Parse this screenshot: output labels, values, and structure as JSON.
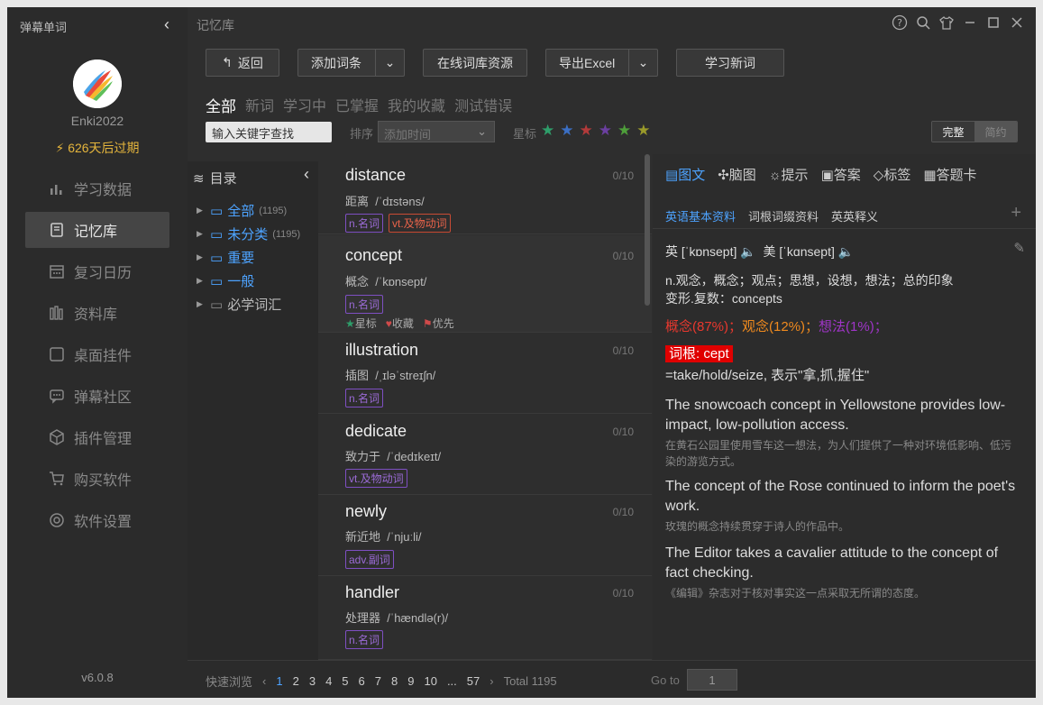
{
  "app": {
    "title": "弹幕单词",
    "username": "Enki2022",
    "expiry": "626天后过期",
    "version": "v6.0.8"
  },
  "nav": [
    {
      "label": "学习数据",
      "icon": "bar-chart-icon"
    },
    {
      "label": "记忆库",
      "icon": "notebook-icon"
    },
    {
      "label": "复习日历",
      "icon": "calendar-icon"
    },
    {
      "label": "资料库",
      "icon": "books-icon"
    },
    {
      "label": "桌面挂件",
      "icon": "widget-icon"
    },
    {
      "label": "弹幕社区",
      "icon": "chat-icon"
    },
    {
      "label": "插件管理",
      "icon": "plugin-icon"
    },
    {
      "label": "购买软件",
      "icon": "cart-icon"
    },
    {
      "label": "软件设置",
      "icon": "settings-icon"
    }
  ],
  "window": {
    "title": "记忆库"
  },
  "toolbar": {
    "back": "返回",
    "add": "添加词条",
    "online": "在线词库资源",
    "export": "导出Excel",
    "learn": "学习新词"
  },
  "filters": {
    "tabs": [
      "全部",
      "新词",
      "学习中",
      "已掌握",
      "我的收藏",
      "测试错误"
    ],
    "search_placeholder": "输入关键字查找",
    "sort_label": "排序",
    "sort_value": "添加时间",
    "star_label": "星标",
    "star_colors": [
      "#2e9e6a",
      "#3b6fc4",
      "#b23a3a",
      "#6b3fa0",
      "#4e9e3a",
      "#9a9a2a"
    ],
    "mode_full": "完整",
    "mode_brief": "简约"
  },
  "tree": {
    "title": "目录",
    "items": [
      {
        "label": "全部",
        "count": "(1195)",
        "color": "#4da3ff"
      },
      {
        "label": "未分类",
        "count": "(1195)",
        "color": "#4da3ff"
      },
      {
        "label": "重要",
        "count": "",
        "color": "#4da3ff"
      },
      {
        "label": "一般",
        "count": "",
        "color": "#4da3ff"
      },
      {
        "label": "必学词汇",
        "count": "",
        "color": "#bbb"
      }
    ]
  },
  "words": [
    {
      "word": "distance",
      "score": "0/10",
      "meaning": "距离",
      "phon": "/ˈdɪstəns/",
      "pos": [
        "n.名词",
        "vt.及物动词"
      ]
    },
    {
      "word": "concept",
      "score": "0/10",
      "meaning": "概念",
      "phon": "/ˈkɒnsept/",
      "pos": [
        "n.名词"
      ],
      "meta": [
        "星标",
        "收藏",
        "优先"
      ]
    },
    {
      "word": "illustration",
      "score": "0/10",
      "meaning": "插图",
      "phon": "/ˌɪləˈstreɪʃn/",
      "pos": [
        "n.名词"
      ]
    },
    {
      "word": "dedicate",
      "score": "0/10",
      "meaning": "致力于",
      "phon": "/ˈdedɪkeɪt/",
      "pos": [
        "vt.及物动词"
      ]
    },
    {
      "word": "newly",
      "score": "0/10",
      "meaning": "新近地",
      "phon": "/ˈnjuːli/",
      "pos": [
        "adv.副词"
      ]
    },
    {
      "word": "handler",
      "score": "0/10",
      "meaning": "处理器",
      "phon": "/ˈhændlə(r)/",
      "pos": [
        "n.名词"
      ]
    }
  ],
  "detail": {
    "tools": [
      "图文",
      "脑图",
      "提示",
      "答案",
      "标签",
      "答题卡"
    ],
    "tabs": [
      "英语基本资料",
      "词根词缀资料",
      "英英释义"
    ],
    "pron_uk": "英 [ˈkɒnsept]",
    "pron_us": "美 [ˈkɑnsept]",
    "def1": "n.观念，概念；观点；思想，设想，想法；总的印象",
    "def2": "变形.复数：concepts",
    "freq": [
      "概念(87%)；",
      "观念(12%)；",
      "想法(1%)；"
    ],
    "root_tag": "词根: cept",
    "root_text": "=take/hold/seize, 表示\"拿,抓,握住\"",
    "examples": [
      {
        "en": "The snowcoach concept in Yellowstone provides low-impact, low-pollution access.",
        "zh": "在黄石公园里使用雪车这一想法，为人们提供了一种对环境低影响、低污染的游览方式。"
      },
      {
        "en": "The concept of the Rose continued to inform the poet's work.",
        "zh": "玫瑰的概念持续贯穿于诗人的作品中。"
      },
      {
        "en": "The Editor takes a cavalier attitude to the concept of fact checking.",
        "zh": "《编辑》杂志对于核对事实这一点采取无所谓的态度。"
      }
    ]
  },
  "footer": {
    "quick": "快速浏览",
    "pages": [
      "1",
      "2",
      "3",
      "4",
      "5",
      "6",
      "7",
      "8",
      "9",
      "10",
      "...",
      "57"
    ],
    "total": "Total 1195",
    "goto_label": "Go to",
    "goto_value": "1"
  }
}
